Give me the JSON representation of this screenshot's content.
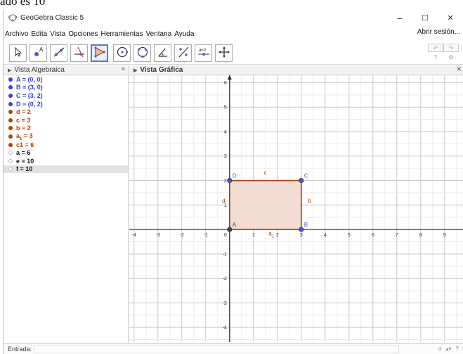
{
  "document": {
    "top_text": "ado es 10"
  },
  "window": {
    "title": "GeoGebra Classic 5",
    "controls": {
      "minimize": "–",
      "maximize": "☐",
      "close": "✕"
    }
  },
  "menu": {
    "items": [
      "Archivo",
      "Edita",
      "Vista",
      "Opciones",
      "Herramientas",
      "Ventana",
      "Ayuda"
    ],
    "signin": "Abrir sesión..."
  },
  "toolbar": {
    "tools": [
      {
        "icon": "move-arrow-icon"
      },
      {
        "icon": "point-icon"
      },
      {
        "icon": "line-icon"
      },
      {
        "icon": "perpendicular-line-icon"
      },
      {
        "icon": "polygon-icon",
        "active": true
      },
      {
        "icon": "circle-center-point-icon"
      },
      {
        "icon": "circle-three-points-icon"
      },
      {
        "icon": "angle-icon"
      },
      {
        "icon": "reflect-icon"
      },
      {
        "icon": "slider-icon",
        "label": "a=2"
      },
      {
        "icon": "move-view-icon"
      }
    ],
    "undo": "↶",
    "redo": "↷",
    "help_icon": "?",
    "settings_icon": "⚙"
  },
  "algebra_view": {
    "title": "Vista Algebraica",
    "close": "✕",
    "items": [
      {
        "name": "A",
        "value": "(0, 0)",
        "color": "#3c3ce0",
        "shown": true
      },
      {
        "name": "B",
        "value": "(3, 0)",
        "color": "#3c3ce0",
        "shown": true
      },
      {
        "name": "C",
        "value": "(3, 2)",
        "color": "#3c3ce0",
        "shown": true
      },
      {
        "name": "D",
        "value": "(0, 2)",
        "color": "#3c3ce0",
        "shown": true
      },
      {
        "name": "d",
        "value": "2",
        "color": "#b34000",
        "shown": true
      },
      {
        "name": "c",
        "value": "3",
        "color": "#b34000",
        "shown": true
      },
      {
        "name": "b",
        "value": "2",
        "color": "#b34000",
        "shown": true
      },
      {
        "name": "a",
        "subscript": "1",
        "value": "3",
        "color": "#b34000",
        "shown": true
      },
      {
        "name": "c1",
        "value": "6",
        "color": "#b34000",
        "shown": true
      },
      {
        "name": "a",
        "value": "6",
        "color": "#111111",
        "shown": false
      },
      {
        "name": "e",
        "value": "10",
        "color": "#111111",
        "shown": false
      },
      {
        "name": "f",
        "value": "10",
        "color": "#111111",
        "shown": false,
        "selected": true
      }
    ]
  },
  "graphics_view": {
    "title": "Vista Gráfica",
    "close": "✕",
    "x_ticks": [
      "-4",
      "-3",
      "-2",
      "-1",
      "0",
      "1",
      "2",
      "3",
      "4",
      "5",
      "6",
      "7",
      "8",
      "9"
    ],
    "y_ticks": [
      "-4",
      "-3",
      "-2",
      "-1",
      "1",
      "2",
      "3",
      "4",
      "5",
      "6"
    ],
    "xlim": [
      -4.2,
      9.8
    ],
    "ylim": [
      -4.6,
      6.3
    ],
    "points": [
      {
        "label": "A",
        "x": 0,
        "y": 0,
        "color": "#444444"
      },
      {
        "label": "B",
        "x": 3,
        "y": 0,
        "color": "#5050d8"
      },
      {
        "label": "C",
        "x": 3,
        "y": 2,
        "color": "#5050d8"
      },
      {
        "label": "D",
        "x": 0,
        "y": 2,
        "color": "#5050d8"
      }
    ],
    "segment_labels": [
      {
        "label": "c",
        "x": 1.5,
        "y": 2.25
      },
      {
        "label": "b",
        "x": 3.35,
        "y": 1.1
      },
      {
        "label": "d",
        "x": -0.25,
        "y": 1.1
      },
      {
        "label": "a",
        "subscript": "1",
        "x": 1.75,
        "y": -0.25
      }
    ],
    "polygon_fill": "#f2d8cc",
    "polygon_stroke": "#a83c10",
    "label_color": "#b34000"
  },
  "input_bar": {
    "label": "Entrada:",
    "icons": [
      "α",
      "▴▾",
      "?"
    ]
  }
}
